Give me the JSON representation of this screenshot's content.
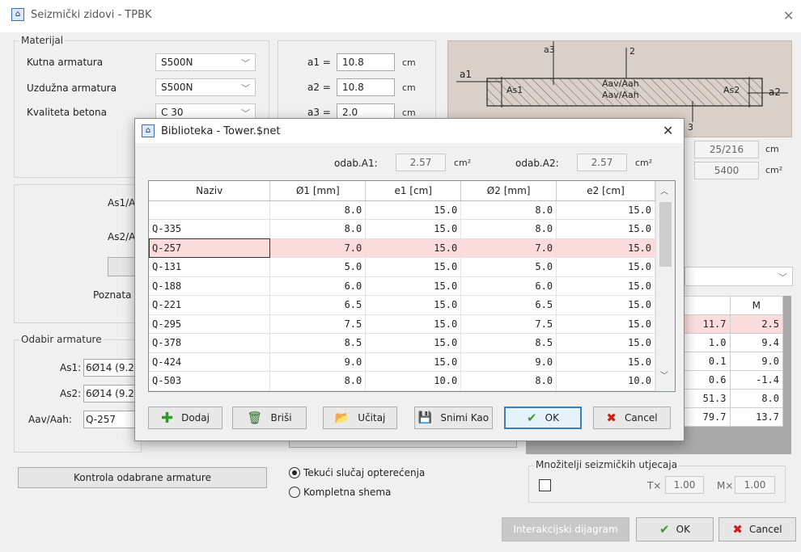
{
  "window": {
    "title": "Seizmički zidovi - TPBK",
    "close_label": "✕"
  },
  "material": {
    "group_label": "Materijal",
    "rows": [
      {
        "label": "Kutna armatura",
        "value": "S500N"
      },
      {
        "label": "Uzdužna armatura",
        "value": "S500N"
      },
      {
        "label": "Kvaliteta betona",
        "value": "C 30"
      }
    ]
  },
  "params": [
    {
      "label": "a1 =",
      "value": "10.8",
      "unit": "cm"
    },
    {
      "label": "a2 =",
      "value": "10.8",
      "unit": "cm"
    },
    {
      "label": "a3 =",
      "value": "2.0",
      "unit": "cm"
    }
  ],
  "diagram": {
    "a1": "a1",
    "a2": "a2",
    "a3": "a3",
    "axis2": "2",
    "axis3": "3",
    "as1": "As1",
    "as2": "As2",
    "aav_top": "Aav/Aah",
    "aav_bottom": "Aav/Aah"
  },
  "dims": {
    "val1": "25/216",
    "unit1": "cm",
    "val2": "5400",
    "unit2": "cm²"
  },
  "left_mid": {
    "as1_label": "As1/A",
    "as2_label": "As2/A",
    "poznata_label": "Poznata"
  },
  "odabir": {
    "group_label": "Odabir armature",
    "as1_label": "As1:",
    "as1_value": "6Ø14 (9.2",
    "as2_label": "As2:",
    "as2_value": "6Ø14 (9.2",
    "aav_label": "Aav/Aah:",
    "aav_value": "Q-257"
  },
  "right_table": {
    "header_m": "M",
    "rows": [
      {
        "a": "11.7",
        "m": "2.5"
      },
      {
        "a": "1.0",
        "m": "9.4"
      },
      {
        "a": "0.1",
        "m": "9.0"
      },
      {
        "a": "0.6",
        "m": "-1.4"
      },
      {
        "a": "51.3",
        "m": "8.0"
      },
      {
        "a": "79.7",
        "m": "13.7"
      }
    ]
  },
  "bottom": {
    "kontrola_label": "Kontrola odabrane armature",
    "radio1": "Tekući slučaj opterećenja",
    "radio2": "Kompletna shema",
    "mnozitelji_label": "Množitelji seizmičkih utjecaja",
    "tx_label": "T×",
    "tx_value": "1.00",
    "mx_label": "M×",
    "mx_value": "1.00",
    "interakcijski_label": "Interakcijski dijagram",
    "ok_label": "OK",
    "cancel_label": "Cancel"
  },
  "dialog": {
    "title": "Biblioteka - Tower.$net",
    "close_label": "✕",
    "odab_a1_label": "odab.A1:",
    "odab_a1_value": "2.57",
    "odab_a1_unit": "cm²",
    "odab_a2_label": "odab.A2:",
    "odab_a2_value": "2.57",
    "odab_a2_unit": "cm²",
    "columns": [
      "Naziv",
      "Ø1 [mm]",
      "e1 [cm]",
      "Ø2 [mm]",
      "e2 [cm]"
    ],
    "rows": [
      [
        "",
        "8.0",
        "15.0",
        "8.0",
        "15.0"
      ],
      [
        "Q-335",
        "8.0",
        "15.0",
        "8.0",
        "15.0"
      ],
      [
        "Q-257",
        "7.0",
        "15.0",
        "7.0",
        "15.0"
      ],
      [
        "Q-131",
        "5.0",
        "15.0",
        "5.0",
        "15.0"
      ],
      [
        "Q-188",
        "6.0",
        "15.0",
        "6.0",
        "15.0"
      ],
      [
        "Q-221",
        "6.5",
        "15.0",
        "6.5",
        "15.0"
      ],
      [
        "Q-295",
        "7.5",
        "15.0",
        "7.5",
        "15.0"
      ],
      [
        "Q-378",
        "8.5",
        "15.0",
        "8.5",
        "15.0"
      ],
      [
        "Q-424",
        "9.0",
        "15.0",
        "9.0",
        "15.0"
      ],
      [
        "Q-503",
        "8.0",
        "10.0",
        "8.0",
        "10.0"
      ]
    ],
    "selected_row": 2,
    "buttons": {
      "dodaj": "Dodaj",
      "brisi": "Briši",
      "ucitaj": "Učitaj",
      "snimi": "Snimi Kao",
      "ok": "OK",
      "cancel": "Cancel"
    }
  }
}
